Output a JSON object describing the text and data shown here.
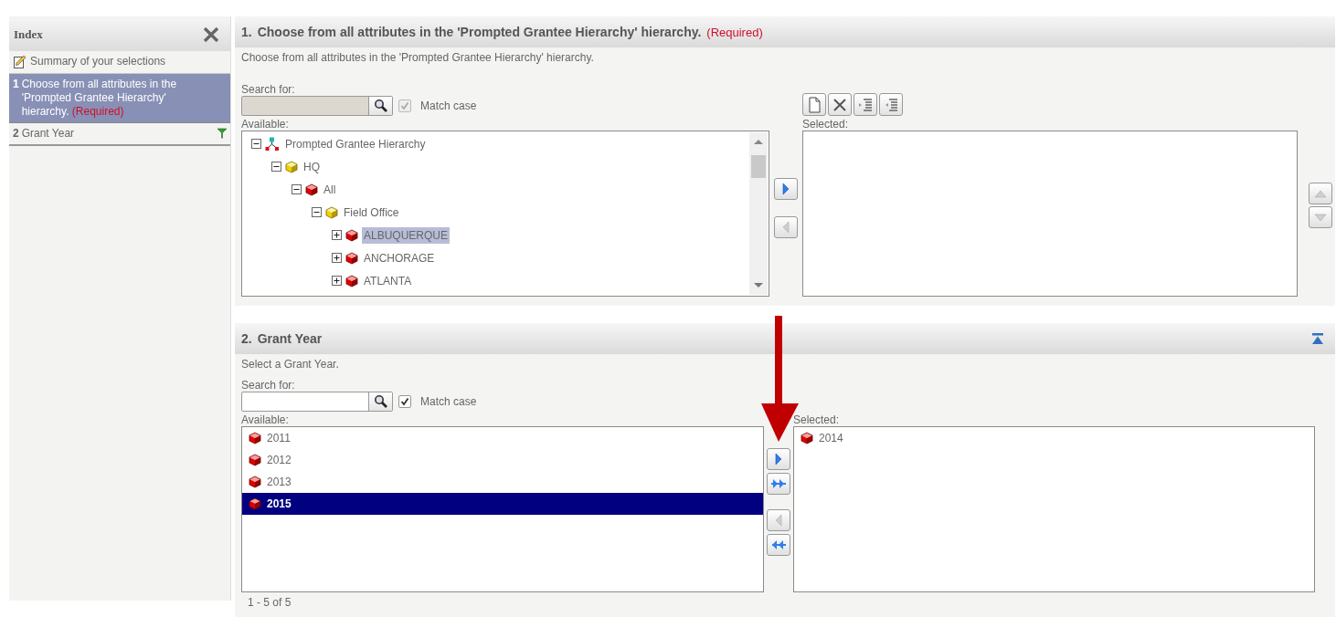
{
  "sidebar": {
    "title": "Index",
    "items": [
      {
        "kind": "summary",
        "label": "Summary of your selections",
        "selected": false
      },
      {
        "kind": "step",
        "number": "1",
        "label": "Choose from all attributes in the 'Prompted Grantee Hierarchy' hierarchy.",
        "required": "(Required)",
        "selected": true,
        "flag": false
      },
      {
        "kind": "step",
        "number": "2",
        "label": "Grant Year",
        "selected": false,
        "flag": true
      }
    ]
  },
  "prompts": [
    {
      "kind": "hierarchy",
      "number": "1.",
      "title": "Choose from all attributes in the 'Prompted Grantee Hierarchy' hierarchy.",
      "required": "(Required)",
      "description": "Choose from all attributes in the 'Prompted Grantee Hierarchy' hierarchy.",
      "search_label": "Search for:",
      "search_disabled": true,
      "match_case": {
        "label": "Match case",
        "checked": true,
        "disabled": true
      },
      "available_label": "Available:",
      "tree": [
        {
          "label": "Prompted Grantee Hierarchy",
          "kind": "hierarchy",
          "expanded": true,
          "selected": false,
          "children": [
            {
              "label": "HQ",
              "kind": "attribute",
              "expanded": true,
              "selected": false,
              "children": [
                {
                  "label": "All",
                  "kind": "element",
                  "expanded": true,
                  "selected": false,
                  "children": [
                    {
                      "label": "Field Office",
                      "kind": "attribute",
                      "expanded": true,
                      "selected": false,
                      "children": [
                        {
                          "label": "ALBUQUERQUE",
                          "kind": "element",
                          "expanded": false,
                          "selected": true
                        },
                        {
                          "label": "ANCHORAGE",
                          "kind": "element",
                          "expanded": false,
                          "selected": false
                        },
                        {
                          "label": "ATLANTA",
                          "kind": "element",
                          "expanded": false,
                          "selected": false
                        }
                      ]
                    }
                  ]
                }
              ]
            }
          ]
        }
      ],
      "toolbar": [
        {
          "kind": "new"
        },
        {
          "kind": "delete"
        },
        {
          "kind": "indent"
        },
        {
          "kind": "outdent"
        }
      ],
      "move_buttons": [
        {
          "kind": "add",
          "disabled": false
        },
        {
          "kind": "remove",
          "disabled": true
        }
      ],
      "order_buttons": [
        {
          "kind": "up",
          "disabled": true
        },
        {
          "kind": "down",
          "disabled": true
        }
      ],
      "selected_label": "Selected:"
    },
    {
      "kind": "list",
      "number": "2.",
      "title": "Grant Year",
      "collapse_button": true,
      "description": "Select a Grant Year.",
      "search_label": "Search for:",
      "search_disabled": false,
      "match_case": {
        "label": "Match case",
        "checked": true,
        "disabled": false
      },
      "available_label": "Available:",
      "available_items": [
        {
          "label": "2011",
          "selected": false
        },
        {
          "label": "2012",
          "selected": false
        },
        {
          "label": "2013",
          "selected": false
        },
        {
          "label": "2015",
          "selected": true
        }
      ],
      "move_buttons": [
        {
          "kind": "add",
          "disabled": false
        },
        {
          "kind": "add_all",
          "disabled": false
        },
        {
          "kind": "remove",
          "disabled": true
        },
        {
          "kind": "remove_all",
          "disabled": false
        }
      ],
      "selected_label": "Selected:",
      "selected_items": [
        {
          "label": "2014",
          "selected": false
        }
      ],
      "pager": "1 - 5 of 5"
    }
  ]
}
